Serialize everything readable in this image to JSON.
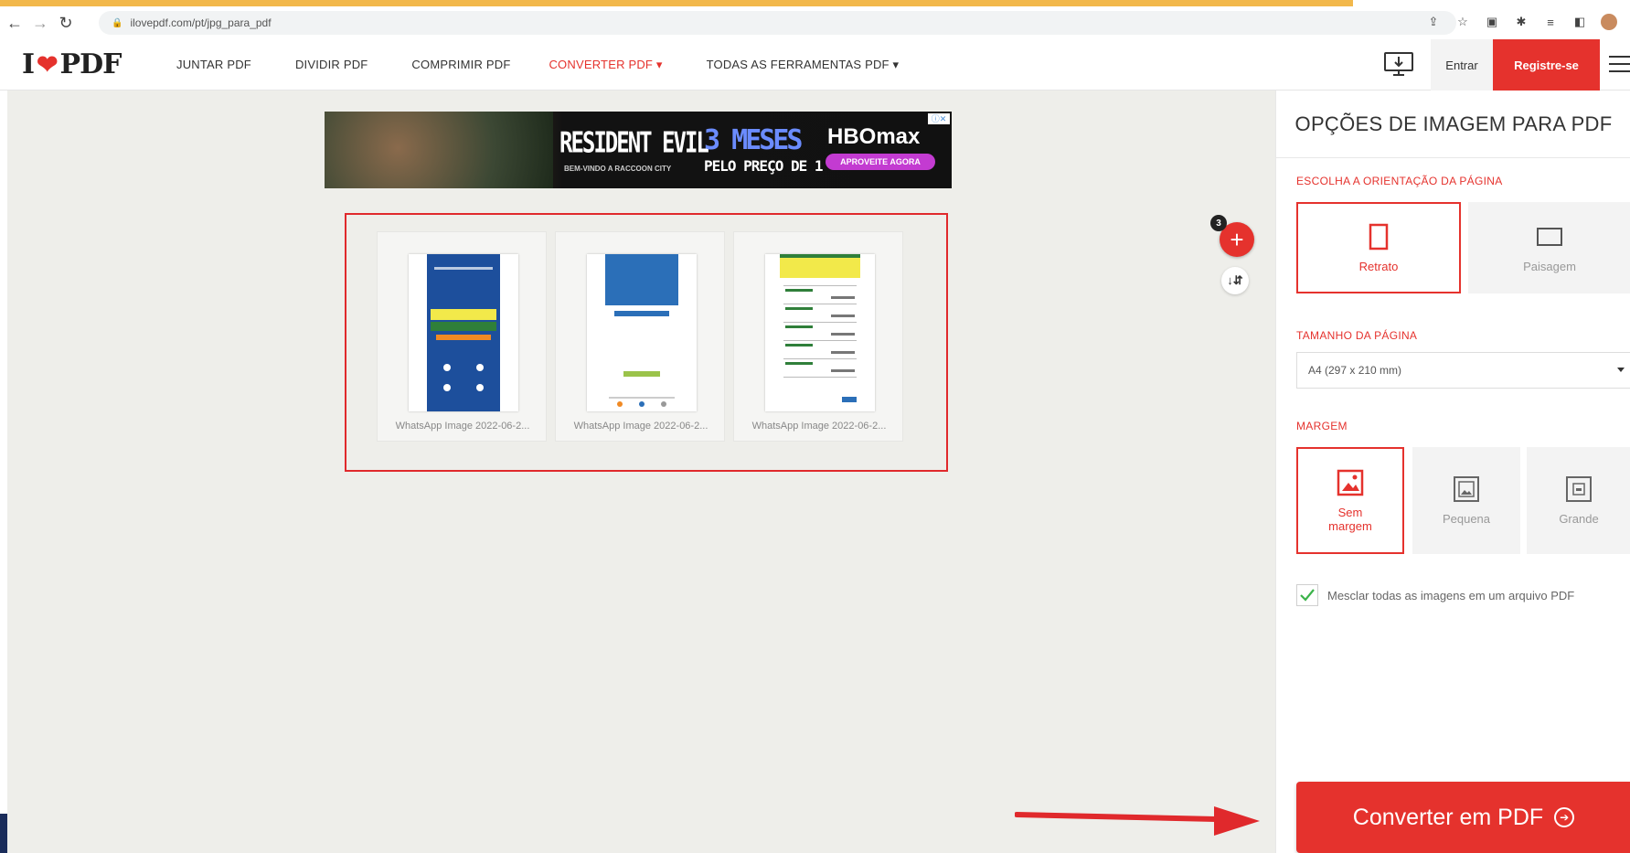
{
  "browser": {
    "url": "ilovepdf.com/pt/jpg_para_pdf"
  },
  "header": {
    "logo_left": "I",
    "logo_right": "PDF",
    "nav": [
      "JUNTAR PDF",
      "DIVIDIR PDF",
      "COMPRIMIR PDF",
      "CONVERTER PDF ▾",
      "TODAS AS FERRAMENTAS PDF ▾"
    ],
    "active_nav_index": 3,
    "login_label": "Entrar",
    "register_label": "Registre-se"
  },
  "ad": {
    "title": "RESIDENT EVIL",
    "subtitle": "BEM-VINDO A RACCOON CITY",
    "offer": "3 MESES",
    "offer_sub": "PELO PREÇO DE 1",
    "brand": "HBOmax",
    "cta": "APROVEITE AGORA"
  },
  "files": [
    {
      "caption": "WhatsApp Image 2022-06-2..."
    },
    {
      "caption": "WhatsApp Image 2022-06-2..."
    },
    {
      "caption": "WhatsApp Image 2022-06-2..."
    }
  ],
  "file_count": "3",
  "sidebar": {
    "title": "OPÇÕES DE IMAGEM PARA PDF",
    "orientation_label": "ESCOLHA A ORIENTAÇÃO DA PÁGINA",
    "orientation_options": [
      "Retrato",
      "Paisagem"
    ],
    "page_size_label": "TAMANHO DA PÁGINA",
    "page_size_value": "A4 (297 x 210 mm)",
    "margin_label": "MARGEM",
    "margin_options": [
      "Sem margem",
      "Pequena",
      "Grande"
    ],
    "merge_label": "Mesclar todas as imagens em um arquivo PDF",
    "convert_label": "Converter em PDF"
  },
  "colors": {
    "brand_red": "#e5322d",
    "workspace_bg": "#eeeeea"
  }
}
